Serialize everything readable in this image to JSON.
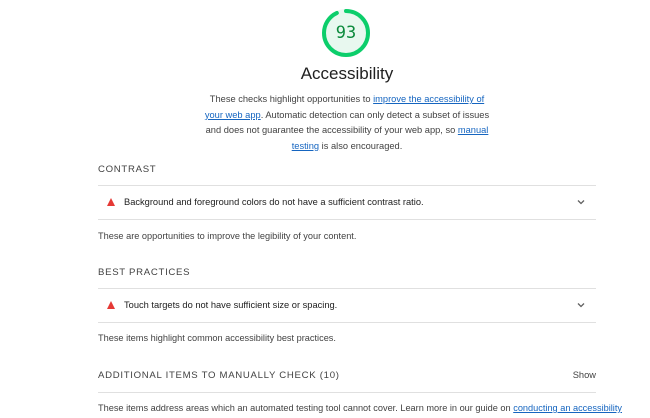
{
  "score": {
    "value": "93",
    "fraction": 0.93,
    "color": "#0cce6b"
  },
  "title": "Accessibility",
  "description": {
    "p1": "These checks highlight opportunities to ",
    "link1": "improve the accessibility of your web app",
    "p2": ". Automatic detection can only detect a subset of issues and does not guarantee the accessibility of your web app, so ",
    "link2": "manual testing",
    "p3": " is also encouraged."
  },
  "sections": {
    "contrast": {
      "heading": "CONTRAST",
      "audit": "Background and foreground colors do not have a sufficient contrast ratio.",
      "note": "These are opportunities to improve the legibility of your content."
    },
    "best_practices": {
      "heading": "BEST PRACTICES",
      "audit": "Touch targets do not have sufficient size or spacing.",
      "note": "These items highlight common accessibility best practices."
    },
    "manual": {
      "heading": "ADDITIONAL ITEMS TO MANUALLY CHECK",
      "count": "(10)",
      "toggle": "Show",
      "note": "These items address areas which an automated testing tool cannot cover. Learn more in our guide on ",
      "note_link": "conducting an accessibility"
    }
  },
  "icons": {
    "audit_status": "fail-triangle-icon",
    "expand": "chevron-down-icon"
  }
}
